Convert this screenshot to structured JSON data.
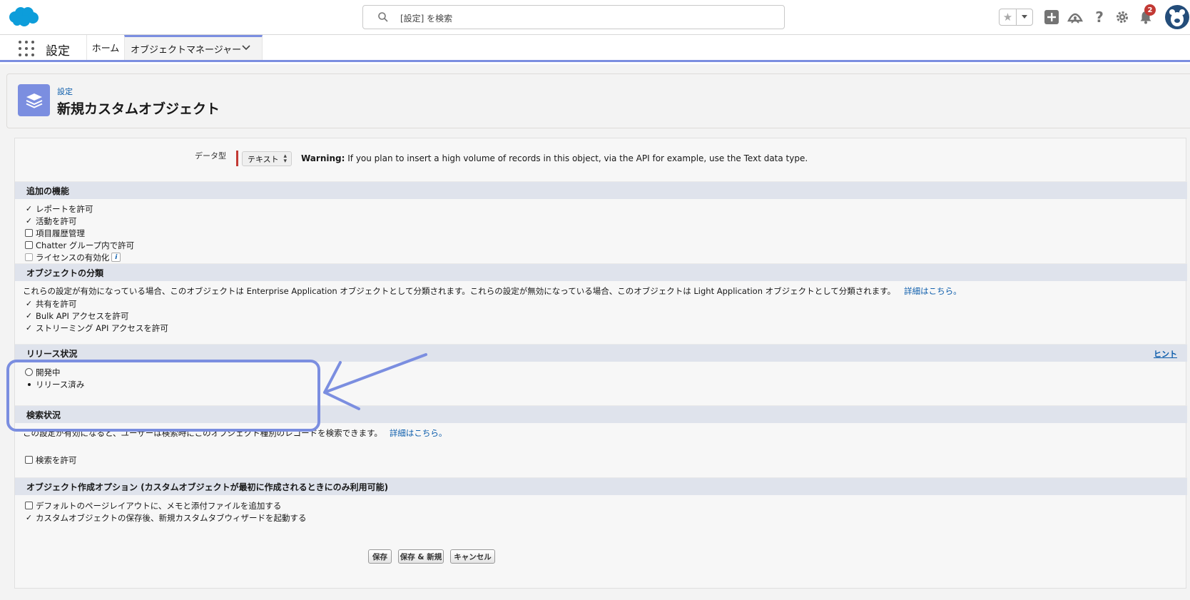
{
  "header": {
    "search_placeholder": "[設定] を検索",
    "notification_count": "2",
    "icons": [
      "salesforce-cloud-logo",
      "search-icon",
      "star-icon",
      "chevron-down-icon",
      "plus-icon",
      "trailhead-icon",
      "help-icon",
      "gear-icon",
      "bell-icon",
      "avatar"
    ]
  },
  "nav": {
    "app_name": "設定",
    "home": "ホーム",
    "object_manager": "オブジェクトマネージャー"
  },
  "page_header": {
    "breadcrumb": "設定",
    "title": "新規カスタムオブジェクト"
  },
  "data_type": {
    "label": "データ型",
    "selected": "テキスト",
    "warning_bold": "Warning:",
    "warning_text": " If you plan to insert a high volume of records in this object, via the API for example, use the Text data type."
  },
  "optional_features": {
    "heading": "追加の機能",
    "items": [
      {
        "label": "レポートを許可",
        "checked": true
      },
      {
        "label": "活動を許可",
        "checked": true
      },
      {
        "label": "項目履歴管理",
        "checked": false
      },
      {
        "label": "Chatter グループ内で許可",
        "checked": false
      },
      {
        "label": "ライセンスの有効化",
        "checked": false
      }
    ],
    "info_glyph": "i"
  },
  "object_classification": {
    "heading": "オブジェクトの分類",
    "description": "これらの設定が有効になっている場合、このオブジェクトは Enterprise Application オブジェクトとして分類されます。これらの設定が無効になっている場合、このオブジェクトは Light Application オブジェクトとして分類されます。",
    "more_link": "詳細はこちら。",
    "items": [
      {
        "label": "共有を許可",
        "checked": true
      },
      {
        "label": "Bulk API アクセスを許可",
        "checked": true
      },
      {
        "label": "ストリーミング API アクセスを許可",
        "checked": true
      }
    ]
  },
  "deployment_status": {
    "heading": "リリース状況",
    "hint": "ヒント",
    "options": [
      {
        "label": "開発中",
        "selected": false
      },
      {
        "label": "リリース済み",
        "selected": true
      }
    ]
  },
  "search_status": {
    "heading": "検索状況",
    "description": "この設定が有効になると、ユーザーは検索時にこのオブジェクト種別のレコードを検索できます。",
    "more_link": "詳細はこちら。",
    "allow_search": "検索を許可"
  },
  "creation_options": {
    "heading": "オブジェクト作成オプション (カスタムオブジェクトが最初に作成されるときにのみ利用可能)",
    "items": [
      {
        "label": "デフォルトのページレイアウトに、メモと添付ファイルを追加する",
        "checked": false
      },
      {
        "label": "カスタムオブジェクトの保存後、新規カスタムタブウィザードを起動する",
        "checked": true
      }
    ]
  },
  "buttons": {
    "save": "保存",
    "save_new": "保存 & 新規",
    "cancel": "キャンセル"
  },
  "colors": {
    "brand_blue": "#0b5cab",
    "object_icon": "#7b8ee0",
    "annotation": "#7b8ee0",
    "section_header": "#dfe3ec",
    "required_bar": "#c23934"
  }
}
